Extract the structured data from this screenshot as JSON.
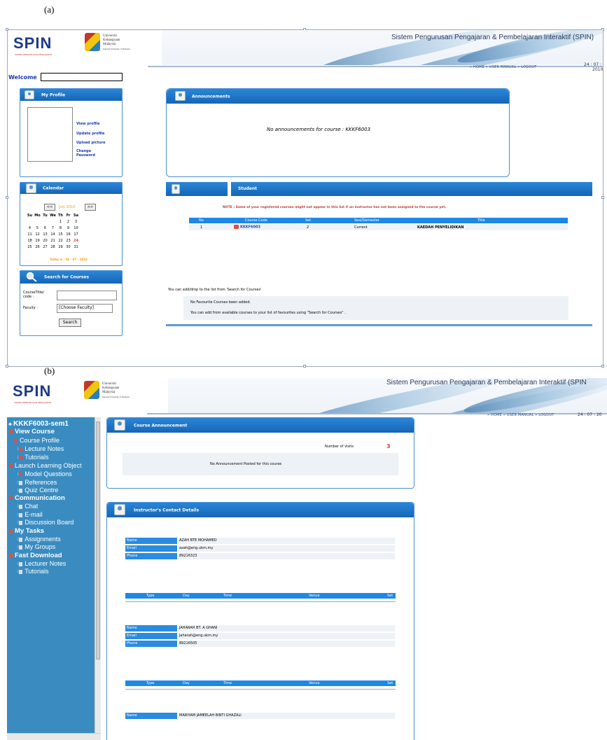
{
  "captions": {
    "a": "(a)",
    "b": "(b)"
  },
  "header": {
    "system_title": "Sistem Pengurusan Pengajaran & Pembelajaran Interaktif (SPIN)",
    "system_title_b": "Sistem Pengurusan Pengajaran & Pembelajaran Interaktif (SPIN",
    "logo": "SPIN",
    "ukm_line1": "Universiti",
    "ukm_line2": "Kebangsaan",
    "ukm_line3": "Malaysia",
    "ukm_line4": "National University of Malaysia",
    "nav": "» HOME  » USER MANUAL  » LOGOUT",
    "date_a": "24 : 07 :",
    "date_a2": "2010",
    "date_b": "24 : 07 : 20"
  },
  "a": {
    "welcome": "Welcome",
    "profile": {
      "title": "My Profile",
      "view": "View profile",
      "update": "Update profile",
      "upload": "Upload picture",
      "change1": "Change",
      "change2": "Password"
    },
    "calendar": {
      "title": "Calendar",
      "prev": "<<",
      "month": "July 2010",
      "next": ">>",
      "days": [
        "Su",
        "Mo",
        "Tu",
        "We",
        "Th",
        "Fr",
        "Sa"
      ],
      "weeks": [
        [
          "",
          "",
          "",
          "",
          "1",
          "2",
          "3"
        ],
        [
          "4",
          "5",
          "6",
          "7",
          "8",
          "9",
          "10"
        ],
        [
          "11",
          "12",
          "13",
          "14",
          "15",
          "16",
          "17"
        ],
        [
          "18",
          "19",
          "20",
          "21",
          "22",
          "23",
          "24"
        ],
        [
          "25",
          "26",
          "27",
          "28",
          "29",
          "30",
          "31"
        ]
      ],
      "today": "Today is : 24 - 07 - 2010"
    },
    "search": {
      "title": "Search for Courses",
      "course_label1": "CourseTitle/",
      "course_label2": "code :",
      "faculty_label": "Faculty :",
      "faculty_value": "[Choose Faculty]",
      "button": "Search"
    },
    "announcements": {
      "title": "Announcements",
      "message": "No announcements for course : KKKF6003"
    },
    "student": {
      "title": "Student",
      "note": "NOTE : Some of your registered courses might not appear in this list if an instructor has not been assigned to the course yet.",
      "headers": [
        "No",
        "Course Code",
        "Set",
        "Sesi/Semester",
        "Title"
      ],
      "row": [
        "1",
        "KKKF6003",
        "2",
        "Current",
        "KAEDAH PENYELIDIKAN"
      ]
    },
    "fav": {
      "intro": "You can add/drop to the list from 'Search for Courses'.",
      "none": "No Favourite Courses been added.",
      "hint": "You can add from available courses to your list of favourites using \"Search for Courses\" ."
    }
  },
  "b": {
    "sidebar": [
      {
        "label": "KKKF6003-sem1",
        "style": "course"
      },
      {
        "label": "View Course",
        "style": "section"
      },
      {
        "label": "Course Profile",
        "style": "sub"
      },
      {
        "label": "Lecture Notes",
        "style": "leaf"
      },
      {
        "label": "Tutorials",
        "style": "leaf"
      },
      {
        "label": "Launch Learning Object",
        "style": "sub"
      },
      {
        "label": "Model Questions",
        "style": "leaf"
      },
      {
        "label": "References",
        "style": "leafg"
      },
      {
        "label": "Quiz Centre",
        "style": "leafg"
      },
      {
        "label": "Communication",
        "style": "section"
      },
      {
        "label": "Chat",
        "style": "leafg"
      },
      {
        "label": "E-mail",
        "style": "leafg"
      },
      {
        "label": "Discussion Board",
        "style": "leafg"
      },
      {
        "label": "My Tasks",
        "style": "section"
      },
      {
        "label": "Assignments",
        "style": "leafg"
      },
      {
        "label": "My Groups",
        "style": "leafg"
      },
      {
        "label": "Fast Download",
        "style": "section"
      },
      {
        "label": "Lecturer Notes",
        "style": "leafg"
      },
      {
        "label": "Tutorials",
        "style": "leafg"
      }
    ],
    "announce": {
      "title": "Course Announcement",
      "visits_label": "Number of visits",
      "visits": "3",
      "message": "No Announcement Posted for this course"
    },
    "contacts": {
      "title": "Instructor's Contact Details",
      "labels": [
        "Name",
        "Email",
        "Phone"
      ],
      "table_headers": [
        "Type",
        "Day",
        "Time",
        "Venue",
        "Set"
      ],
      "people": [
        {
          "name": "AZAH BTE MOHAMED",
          "email": "azah@eng.ukm.my",
          "phone": "89216323"
        },
        {
          "name": "JAHARAH BT. A GHANI",
          "email": "jaharah@eng.ukm.my",
          "phone": "89216505"
        },
        {
          "name": "MARIYAM JAMEELAH BINTI GHAZALI"
        }
      ]
    }
  }
}
